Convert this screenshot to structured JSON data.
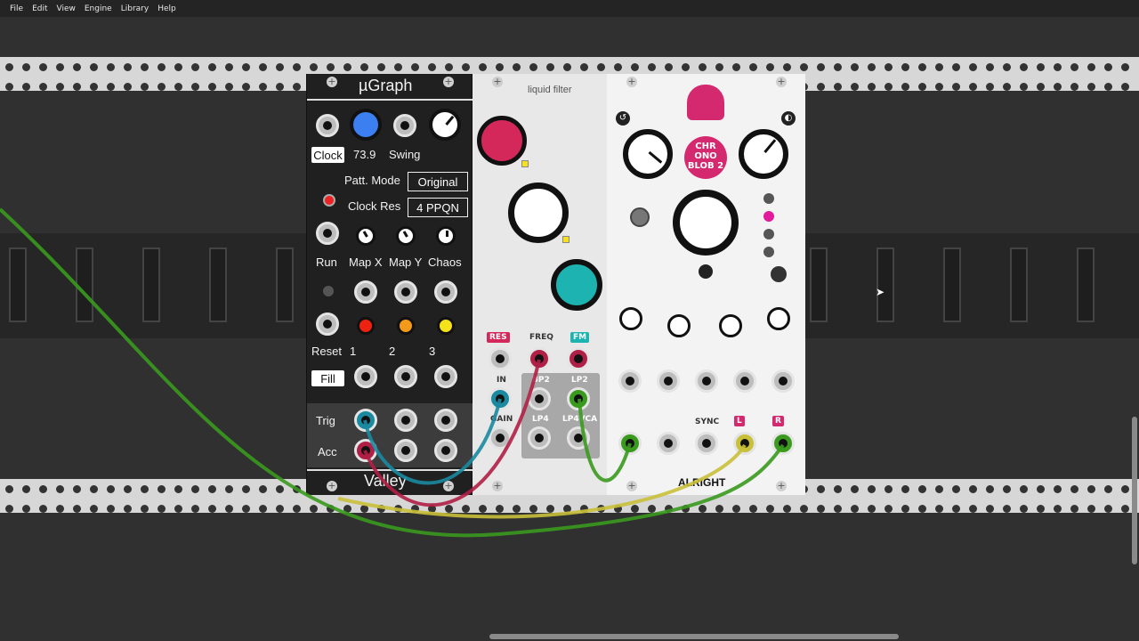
{
  "menu": [
    "File",
    "Edit",
    "View",
    "Engine",
    "Library",
    "Help"
  ],
  "ugraph": {
    "title": "µGraph",
    "clock_btn": "Clock",
    "bpm": "73.9",
    "swing": "Swing",
    "patt_mode_label": "Patt. Mode",
    "patt_mode_value": "Original",
    "clock_res_label": "Clock Res",
    "clock_res_value": "4 PPQN",
    "run": "Run",
    "map_x": "Map X",
    "map_y": "Map Y",
    "chaos": "Chaos",
    "reset": "Reset",
    "ch1": "1",
    "ch2": "2",
    "ch3": "3",
    "fill": "Fill",
    "trig": "Trig",
    "acc": "Acc",
    "brand": "Valley"
  },
  "liquid": {
    "title": "liquid filter",
    "res": "RES",
    "freq": "FREQ",
    "fm": "FM",
    "in": "IN",
    "bp2": "BP2",
    "lp2": "LP2",
    "gain": "GAIN",
    "lp4": "LP4",
    "lp4vca": "LP4VCA"
  },
  "chrono": {
    "logo_text": "CHR ONO BLOB 2",
    "sync": "SYNC",
    "l_label": "L",
    "r_label": "R",
    "brand": "ALRIGHT"
  },
  "colors": {
    "accent_red": "#d4285a",
    "accent_teal": "#1db3b0",
    "accent_blue": "#3b7ff0",
    "cable_green": "#3a9a1e",
    "cable_yellow": "#c9c03a",
    "cable_red": "#b01f45",
    "cable_teal": "#1a8aa0"
  }
}
